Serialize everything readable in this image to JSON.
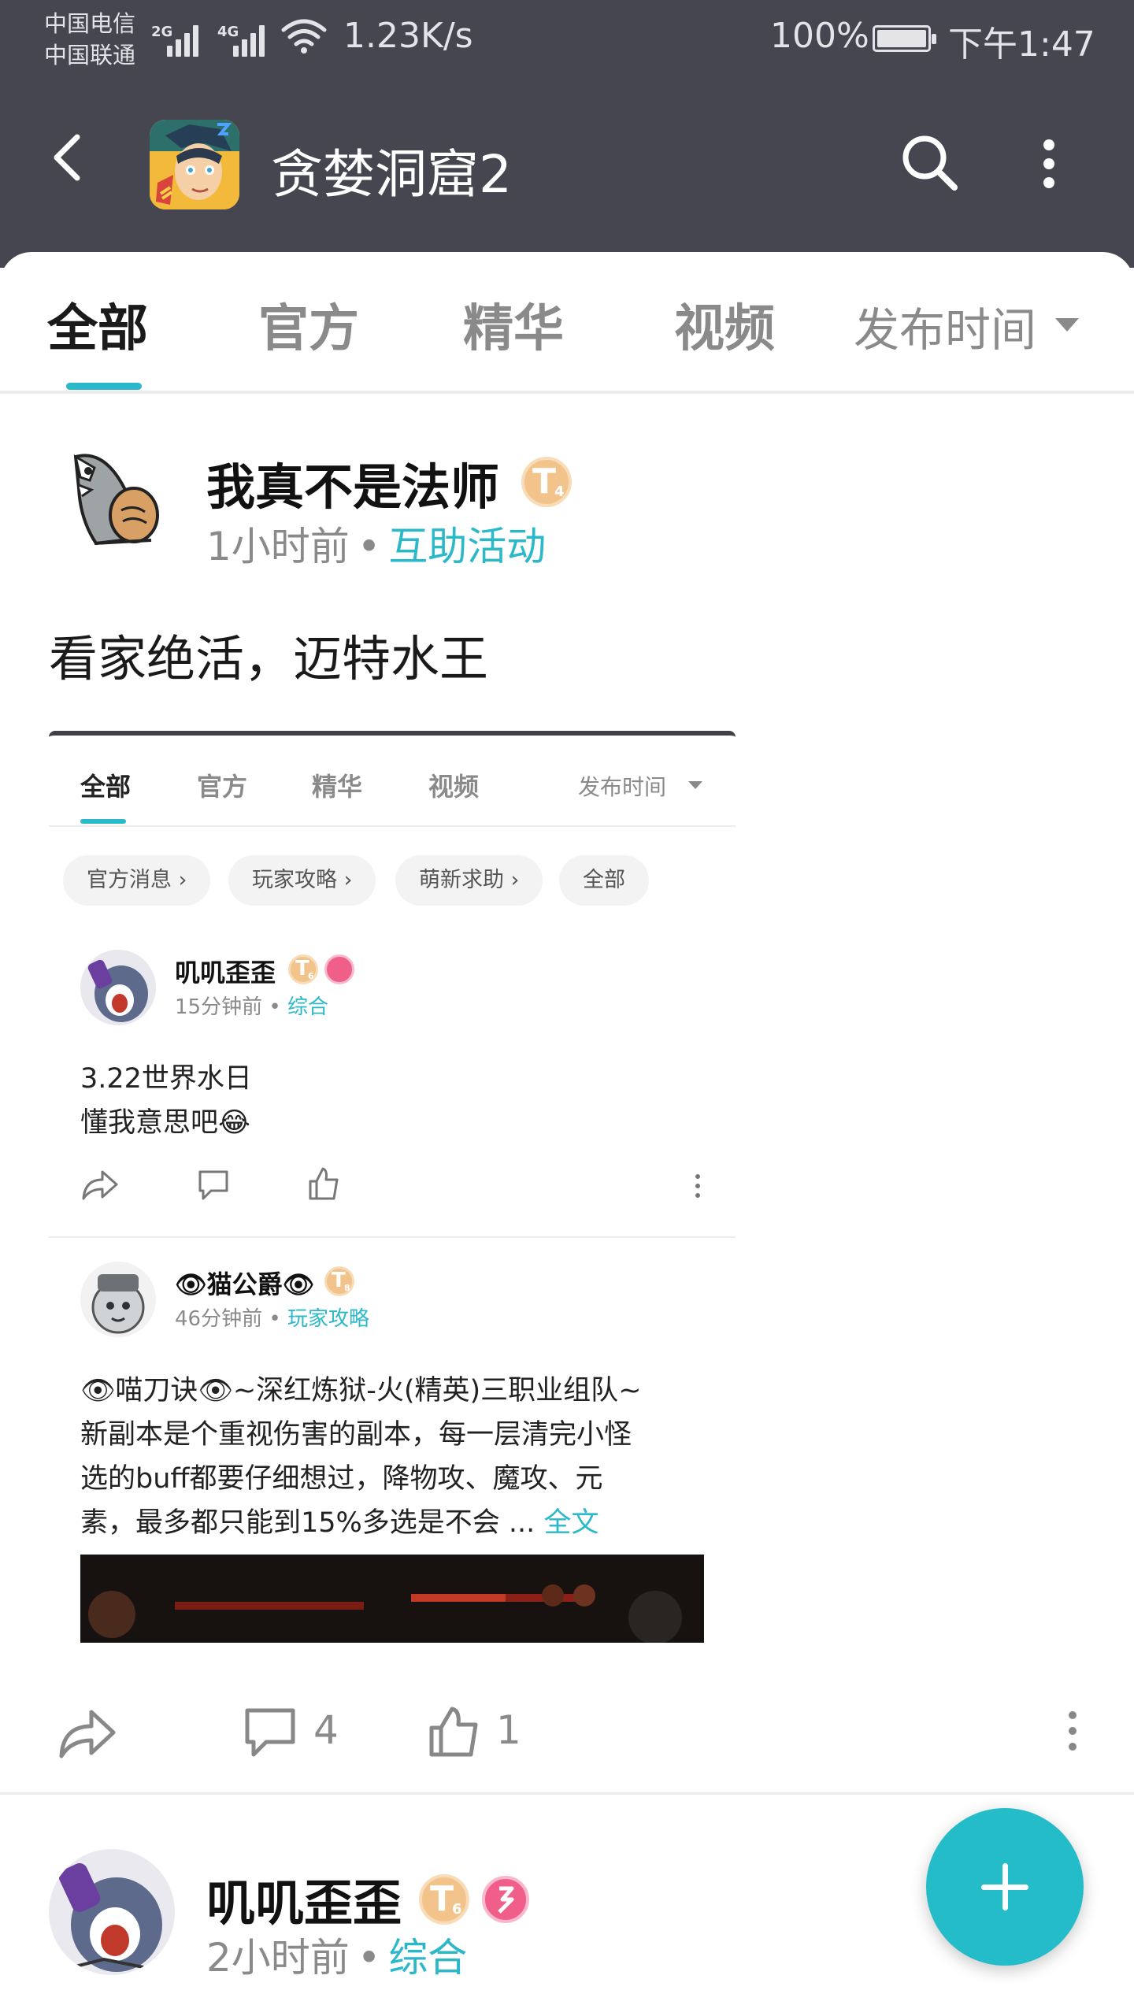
{
  "status_bar": {
    "carrier1": "中国电信",
    "carrier2": "中国联通",
    "net1": "2G",
    "net2": "4G",
    "speed": "1.23K/s",
    "battery": "100%",
    "time": "下午1:47"
  },
  "header": {
    "title": "贪婪洞窟2",
    "back_icon": "back-arrow-icon",
    "search_icon": "search-icon",
    "more_icon": "more-vertical-icon",
    "bg_color": "#45464f"
  },
  "tabs": [
    {
      "label": "全部"
    },
    {
      "label": "官方"
    },
    {
      "label": "精华"
    },
    {
      "label": "视频"
    }
  ],
  "sort_label": "发布时间",
  "accent_color": "#2bb8c9",
  "posts": [
    {
      "author": "我真不是法师",
      "badge": "T",
      "badge_level": "4",
      "time": "1小时前",
      "category": "互助活动",
      "text": "看家绝活，迈特水王",
      "screenshot": {
        "tabs": [
          "全部",
          "官方",
          "精华",
          "视频"
        ],
        "sort_label": "发布时间",
        "chips": [
          "官方消息 ›",
          "玩家攻略 ›",
          "萌新求助 ›",
          "全部"
        ],
        "posts": [
          {
            "author": "叽叽歪歪",
            "badge": "T",
            "badge_level": "6",
            "time": "15分钟前",
            "category": "综合",
            "lines": [
              "3.22世界水日",
              "懂我意思吧😂"
            ]
          },
          {
            "author": "👁猫公爵👁",
            "badge": "T",
            "badge_level": "8",
            "time": "46分钟前",
            "category": "玩家攻略",
            "lines": [
              "👁喵刀诀👁~深红炼狱-火(精英)三职业组队~",
              "新副本是个重视伤害的副本，每一层清完小怪",
              "选的buff都要仔细想过，降物攻、魔攻、元",
              "素，最多都只能到15%多选是不会 ..."
            ],
            "more": "全文"
          }
        ]
      },
      "comments": "4",
      "likes": "1"
    },
    {
      "author": "叽叽歪歪",
      "badge": "T",
      "badge_level": "6",
      "time": "2小时前",
      "category": "综合"
    }
  ],
  "fab_icon": "plus-icon"
}
